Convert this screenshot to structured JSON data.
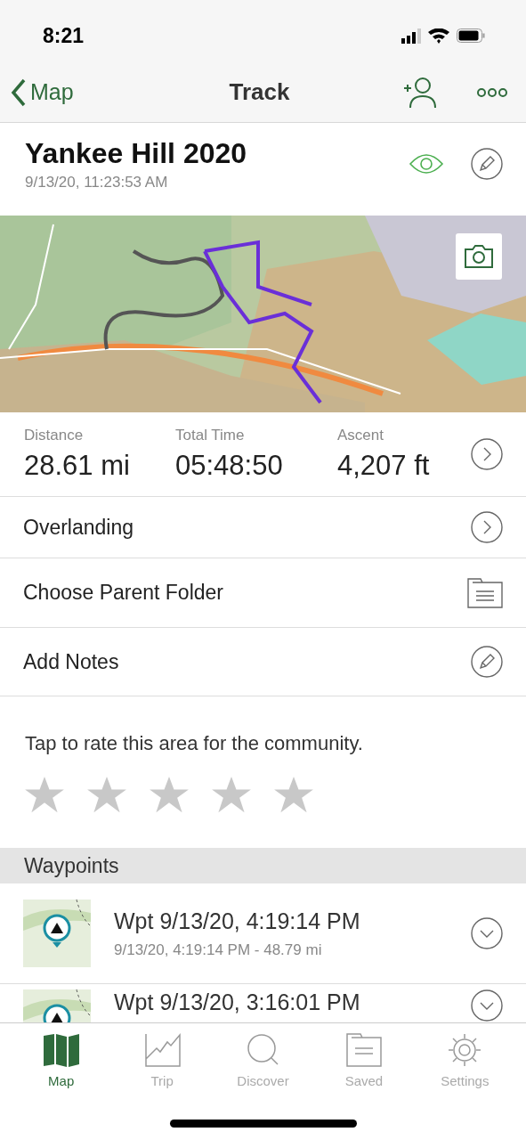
{
  "status_bar": {
    "time": "8:21"
  },
  "nav": {
    "back": "Map",
    "title": "Track"
  },
  "track": {
    "name": "Yankee Hill 2020",
    "date": "9/13/20, 11:23:53 AM",
    "visible": true
  },
  "stats": [
    {
      "label": "Distance",
      "value": "28.61 mi"
    },
    {
      "label": "Total Time",
      "value": "05:48:50"
    },
    {
      "label": "Ascent",
      "value": "4,207 ft"
    }
  ],
  "rows": [
    {
      "label": "Overlanding",
      "kind": "chevron"
    },
    {
      "label": "Choose Parent Folder",
      "kind": "folder"
    },
    {
      "label": "Add Notes",
      "kind": "edit"
    }
  ],
  "rating": {
    "prompt": "Tap to rate this area for the community.",
    "stars": 0
  },
  "waypoints": {
    "header": "Waypoints",
    "items": [
      {
        "title": "Wpt 9/13/20, 4:19:14 PM",
        "subtitle": "9/13/20, 4:19:14 PM - 48.79 mi"
      },
      {
        "title": "Wpt 9/13/20, 3:16:01 PM"
      }
    ]
  },
  "tab_bar": [
    {
      "label": "Map",
      "kind": "map",
      "selected": true
    },
    {
      "label": "Trip",
      "kind": "trip",
      "selected": false
    },
    {
      "label": "Discover",
      "kind": "discover",
      "selected": false
    },
    {
      "label": "Saved",
      "kind": "saved",
      "selected": false
    },
    {
      "label": "Settings",
      "kind": "settings",
      "selected": false
    }
  ]
}
